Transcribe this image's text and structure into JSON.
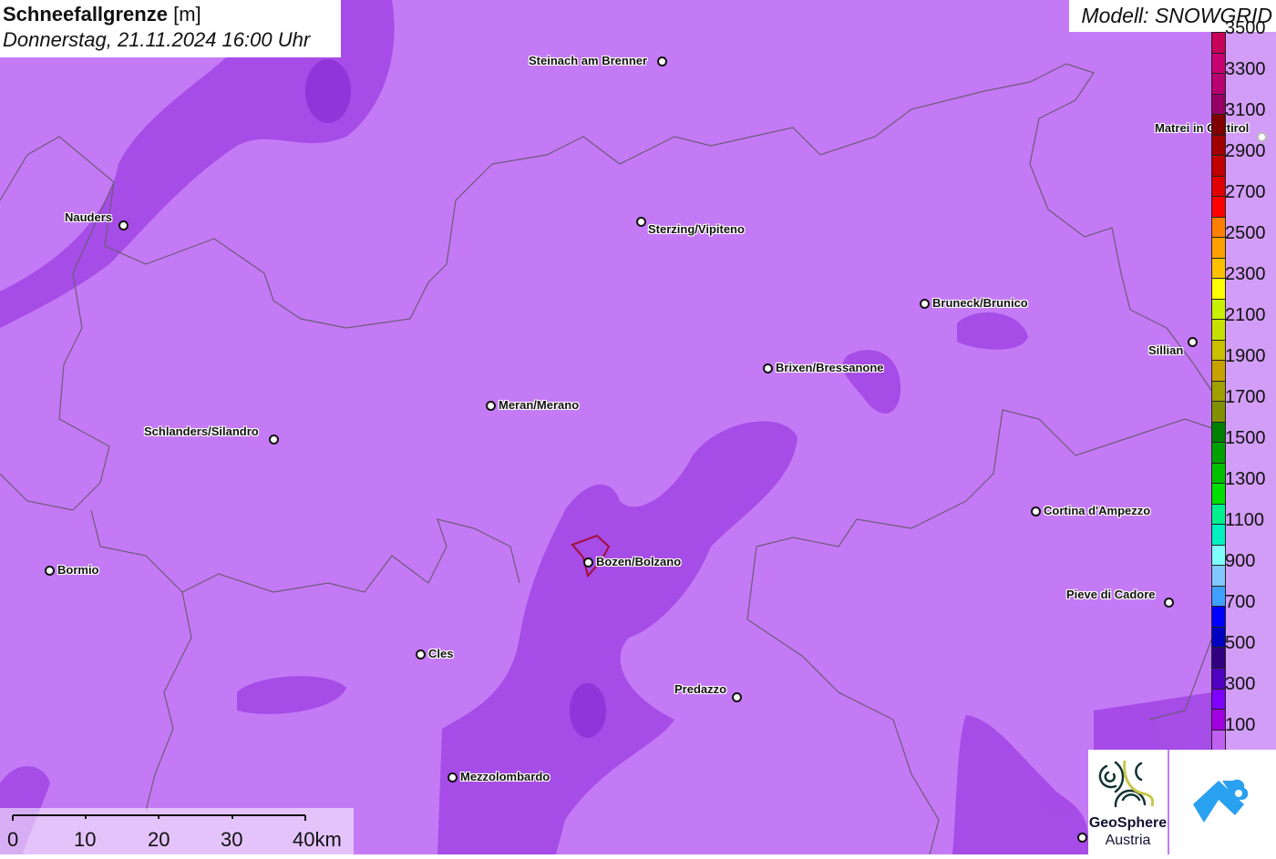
{
  "title": {
    "parameter": "Schneefallgrenze",
    "unit": "[m]",
    "datetime": "Donnerstag, 21.11.2024 16:00 Uhr"
  },
  "model": "Modell: SNOWGRID",
  "colors": {
    "background": "#c47af5",
    "dark_zone": "#a347e6",
    "darker_zone": "#8a2fd6",
    "border": "#6e5a7a"
  },
  "cities": [
    {
      "name": "Steinach am Brenner"
    },
    {
      "name": "Matrei in Osttirol"
    },
    {
      "name": "Nauders"
    },
    {
      "name": "Sterzing/Vipiteno"
    },
    {
      "name": "Bruneck/Brunico"
    },
    {
      "name": "Sillian"
    },
    {
      "name": "Brixen/Bressanone"
    },
    {
      "name": "Meran/Merano"
    },
    {
      "name": "Schlanders/Silandro"
    },
    {
      "name": "Cortina d'Ampezzo"
    },
    {
      "name": "Bormio"
    },
    {
      "name": "Bozen/Bolzano"
    },
    {
      "name": "Pieve di Cadore"
    },
    {
      "name": "Cles"
    },
    {
      "name": "Predazzo"
    },
    {
      "name": "Mezzolombardo"
    }
  ],
  "legend": {
    "ticks": [
      "3500",
      "3300",
      "3100",
      "2900",
      "2700",
      "2500",
      "2300",
      "2100",
      "1900",
      "1700",
      "1500",
      "1300",
      "1100",
      "900",
      "700",
      "500",
      "300",
      "100"
    ],
    "colors": [
      "#c8005a",
      "#c80070",
      "#b80070",
      "#960064",
      "#800000",
      "#a00000",
      "#c00000",
      "#e00000",
      "#ff0000",
      "#ff8000",
      "#ffa000",
      "#ffc000",
      "#ffff00",
      "#c8f000",
      "#c8e000",
      "#c8c000",
      "#c8a000",
      "#a0a000",
      "#809000",
      "#008000",
      "#00a000",
      "#00c000",
      "#00e000",
      "#00f090",
      "#00f0c0",
      "#80ffff",
      "#80c8ff",
      "#40a0ff",
      "#0000ff",
      "#0000c0",
      "#300080",
      "#5000c0",
      "#8000ff",
      "#a000e0",
      "#c060f0"
    ]
  },
  "scale": {
    "labels": [
      "0",
      "10",
      "20",
      "30",
      "40km"
    ]
  },
  "logos": {
    "geosphere": "GeoSphere",
    "austria": "Austria"
  }
}
